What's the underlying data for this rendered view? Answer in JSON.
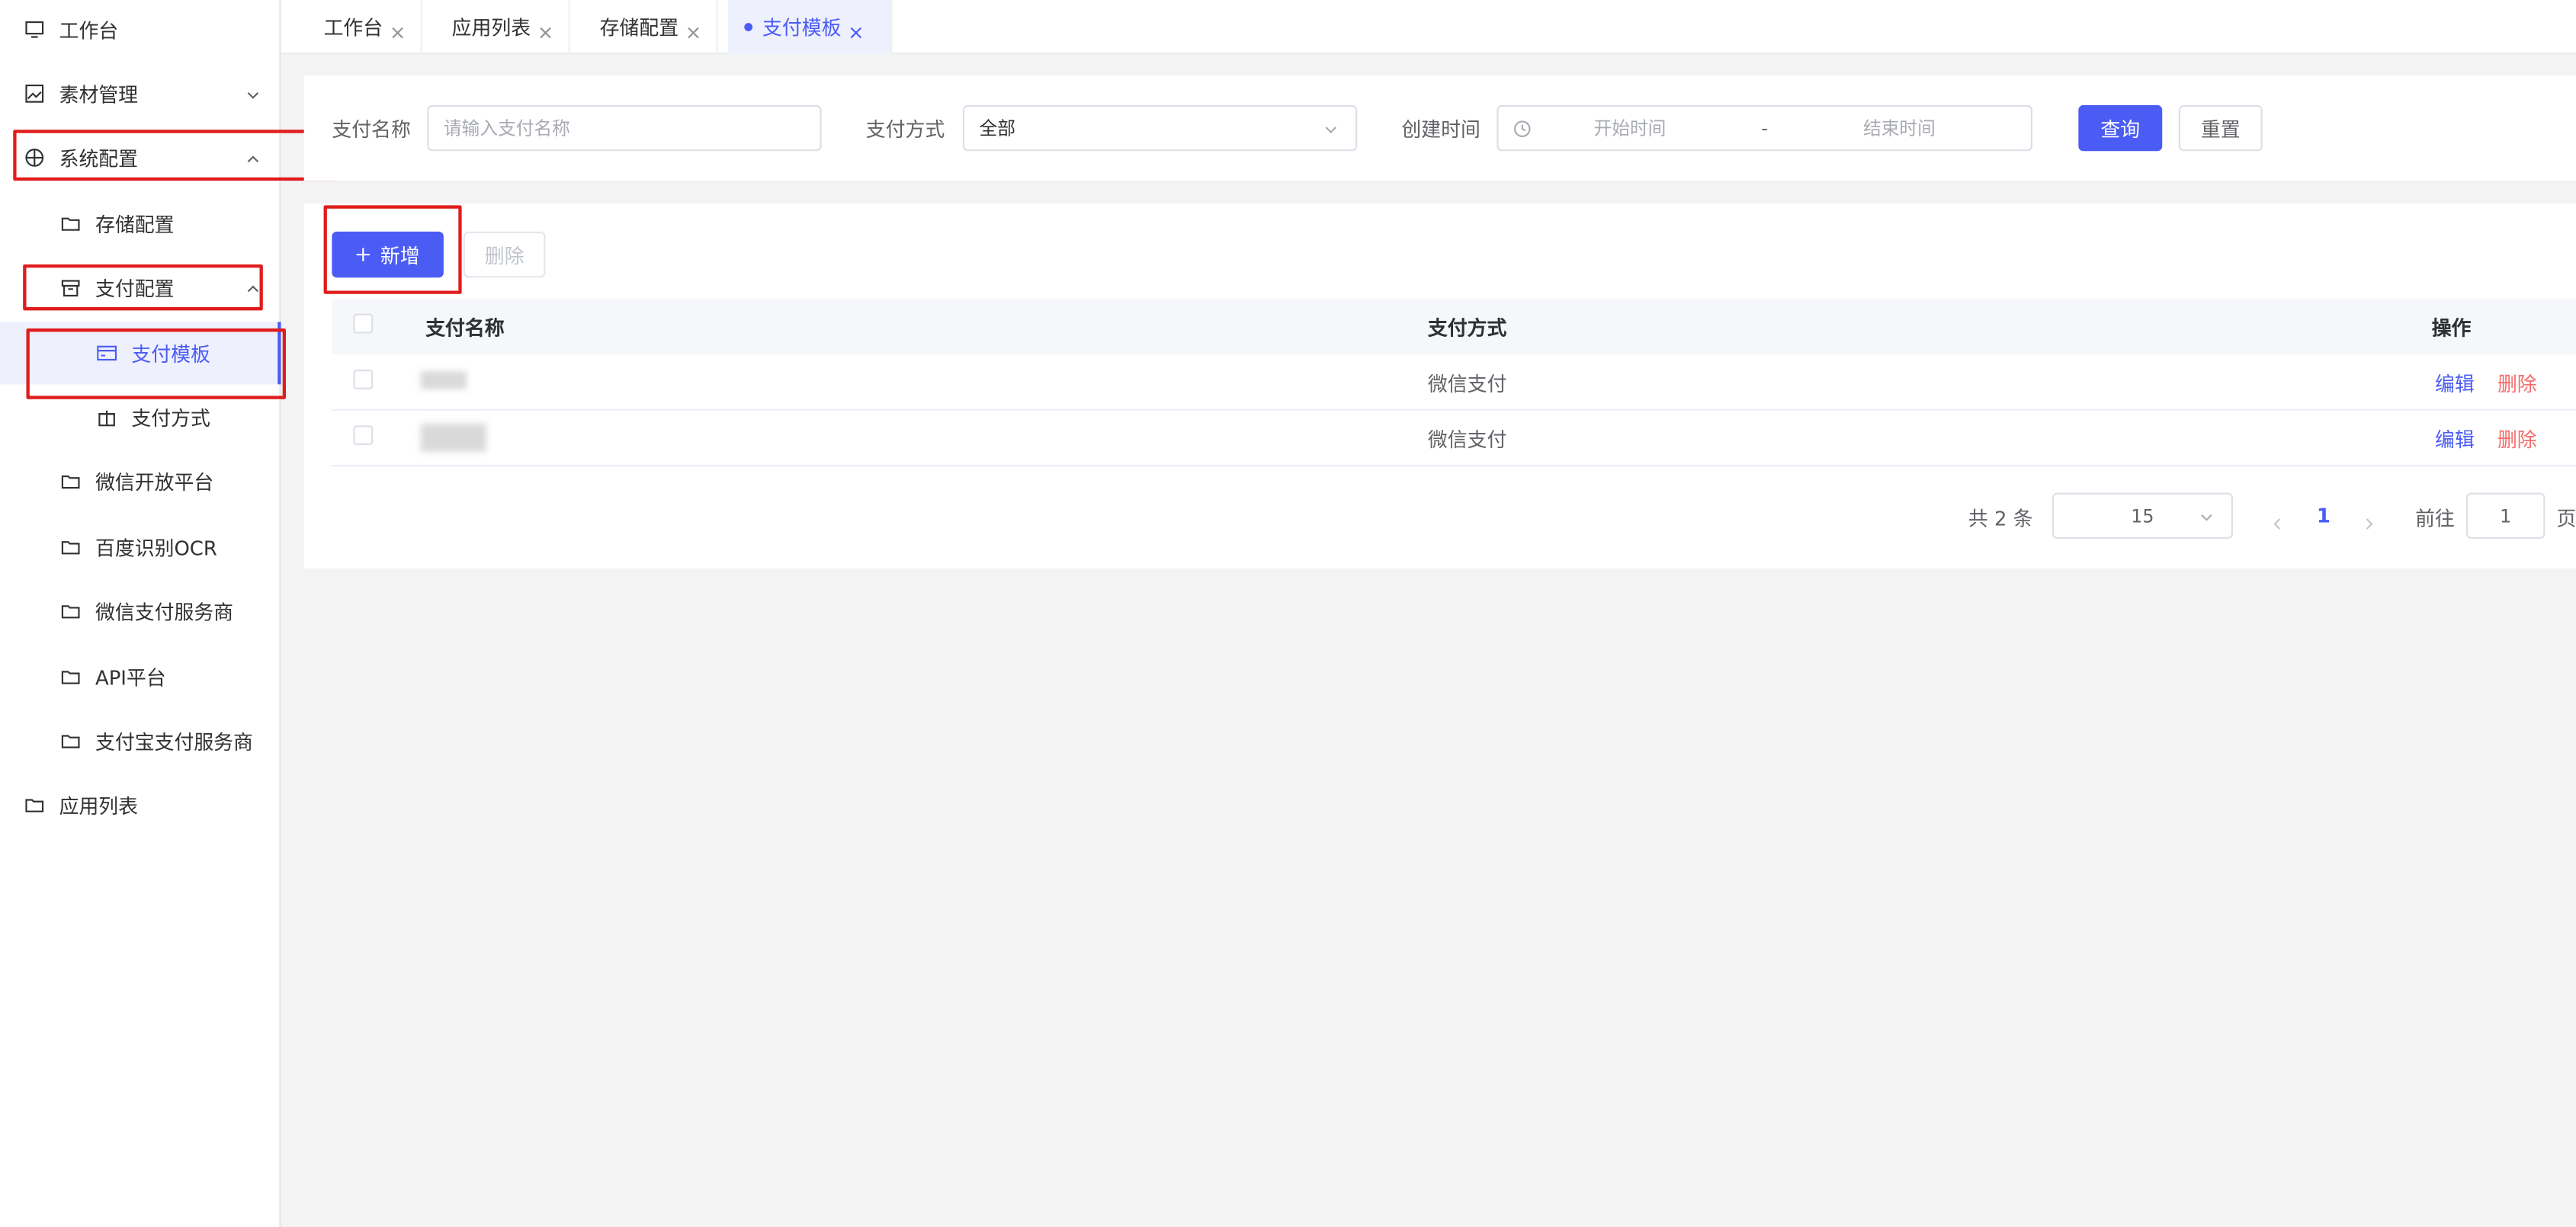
{
  "sidebar": {
    "items": [
      {
        "label": "工作台",
        "icon": "monitor-icon"
      },
      {
        "label": "素材管理",
        "icon": "image-icon"
      },
      {
        "label": "系统配置",
        "icon": "aperture-icon"
      },
      {
        "label": "存储配置",
        "icon": "folder-icon"
      },
      {
        "label": "支付配置",
        "icon": "archive-box-icon"
      },
      {
        "label": "支付模板",
        "icon": "credit-card-icon"
      },
      {
        "label": "支付方式",
        "icon": "gift-box-icon"
      },
      {
        "label": "微信开放平台",
        "icon": "folder-icon"
      },
      {
        "label": "百度识别OCR",
        "icon": "folder-icon"
      },
      {
        "label": "微信支付服务商",
        "icon": "folder-icon"
      },
      {
        "label": "API平台",
        "icon": "folder-icon"
      },
      {
        "label": "支付宝支付服务商",
        "icon": "folder-icon"
      },
      {
        "label": "应用列表",
        "icon": "folder-icon"
      }
    ]
  },
  "tabs": [
    {
      "label": "工作台"
    },
    {
      "label": "应用列表"
    },
    {
      "label": "存储配置"
    },
    {
      "label": "支付模板",
      "active": true
    }
  ],
  "search": {
    "name_label": "支付名称",
    "name_placeholder": "请输入支付名称",
    "method_label": "支付方式",
    "method_value": "全部",
    "created_label": "创建时间",
    "start_placeholder": "开始时间",
    "range_sep": "-",
    "end_placeholder": "结束时间",
    "query_label": "查询",
    "reset_label": "重置"
  },
  "toolbar": {
    "add_label": "新增",
    "delete_label": "删除"
  },
  "table": {
    "columns": [
      "支付名称",
      "支付方式",
      "操作"
    ],
    "rows": [
      {
        "method": "微信支付",
        "edit": "编辑",
        "delete": "删除"
      },
      {
        "method": "微信支付",
        "edit": "编辑",
        "delete": "删除"
      }
    ]
  },
  "pagination": {
    "total_text": "共 2 条",
    "page_size": "15",
    "current_page": "1",
    "goto_label": "前往",
    "goto_value": "1",
    "page_suffix": "页"
  },
  "colors": {
    "primary": "#4b5cf5",
    "danger": "#f56c6c",
    "highlight": "#e01c1c"
  }
}
